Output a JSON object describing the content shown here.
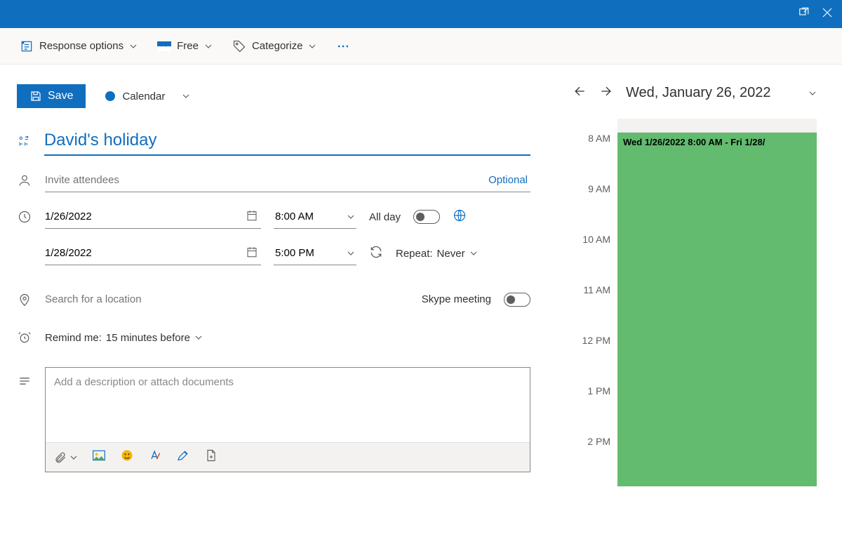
{
  "ribbon": {
    "response_options": "Response options",
    "free": "Free",
    "categorize": "Categorize"
  },
  "form": {
    "save_label": "Save",
    "calendar_label": "Calendar",
    "title": "David's holiday",
    "attendees_placeholder": "Invite attendees",
    "optional_label": "Optional",
    "start_date": "1/26/2022",
    "start_time": "8:00 AM",
    "all_day_label": "All day",
    "end_date": "1/28/2022",
    "end_time": "5:00 PM",
    "repeat_label": "Repeat:",
    "repeat_value": "Never",
    "location_placeholder": "Search for a location",
    "skype_label": "Skype meeting",
    "remind_label": "Remind me:",
    "remind_value": "15 minutes before",
    "description_placeholder": "Add a description or attach documents"
  },
  "schedule": {
    "date_header": "Wed, January 26, 2022",
    "hours": [
      "8 AM",
      "9 AM",
      "10 AM",
      "11 AM",
      "12 PM",
      "1 PM",
      "2 PM"
    ],
    "event_label": "Wed 1/26/2022 8:00 AM - Fri 1/28/"
  },
  "colors": {
    "accent": "#106ebe",
    "event_block": "#62bb6f"
  }
}
